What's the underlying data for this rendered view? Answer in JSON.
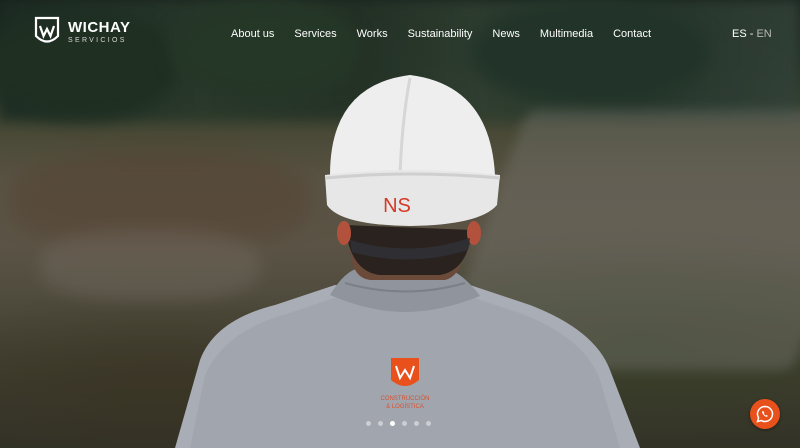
{
  "brand": {
    "name": "WICHAY",
    "tagline": "SERVICIOS",
    "accent_color": "#e8501c"
  },
  "nav": {
    "items": [
      {
        "label": "About us"
      },
      {
        "label": "Services"
      },
      {
        "label": "Works"
      },
      {
        "label": "Sustainability"
      },
      {
        "label": "News"
      },
      {
        "label": "Multimedia"
      },
      {
        "label": "Contact"
      }
    ]
  },
  "language": {
    "es": "ES",
    "separator": " - ",
    "en": "EN"
  },
  "hero": {
    "helmet_text": "NS",
    "shirt_badge_line1": "CONSTRUCCIÓN",
    "shirt_badge_line2": "& LOGÍSTICA",
    "slides_total": 6,
    "active_slide": 2
  },
  "floating": {
    "icon": "whatsapp-icon"
  }
}
